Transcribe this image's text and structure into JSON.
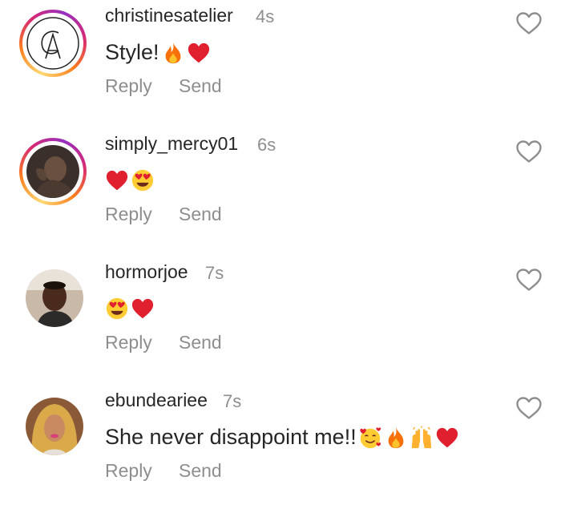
{
  "comments": [
    {
      "username": "christinesatelier",
      "time": "4s",
      "text": "Style!",
      "emojis": [
        "fire-emoji",
        "red-heart-emoji"
      ],
      "avatar_monogram": "CA",
      "reply_label": "Reply",
      "send_label": "Send",
      "like_icon": "heart-outline-icon"
    },
    {
      "username": "simply_mercy01",
      "time": "6s",
      "text": "",
      "emojis": [
        "red-heart-emoji",
        "heart-eyes-emoji"
      ],
      "reply_label": "Reply",
      "send_label": "Send",
      "like_icon": "heart-outline-icon"
    },
    {
      "username": "hormorjoe",
      "time": "7s",
      "text": "",
      "emojis": [
        "heart-eyes-emoji",
        "red-heart-emoji"
      ],
      "reply_label": "Reply",
      "send_label": "Send",
      "like_icon": "heart-outline-icon"
    },
    {
      "username": "ebundeariee",
      "time": "7s",
      "text": "She never disappoint me!!",
      "emojis": [
        "smiling-face-with-hearts-emoji",
        "fire-emoji",
        "raising-hands-emoji",
        "red-heart-emoji"
      ],
      "reply_label": "Reply",
      "send_label": "Send",
      "like_icon": "heart-outline-icon"
    }
  ],
  "colors": {
    "text": "#262626",
    "secondary": "#8e8e8e",
    "story_ring_start": "#feda75",
    "story_ring_mid": "#d62976",
    "story_ring_end": "#962fbf"
  }
}
